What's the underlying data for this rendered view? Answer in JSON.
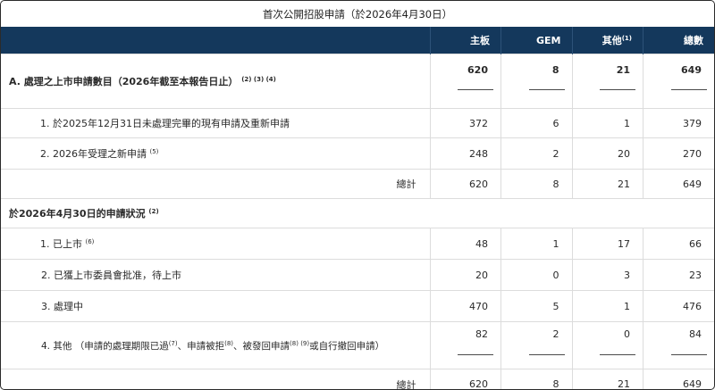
{
  "caption": "首次公開招股申請（於2026年4月30日）",
  "header": {
    "main_board": "主板",
    "gem": "GEM",
    "other": "其他",
    "other_note": "(1)",
    "total": "總數"
  },
  "section_a": {
    "label": "A. 處理之上市申請數目（2026年截至本報告日止）",
    "notes": "(2) (3) (4)",
    "values": [
      "620",
      "8",
      "21",
      "649"
    ],
    "rows": [
      {
        "label": "1. 於2025年12月31日未處理完畢的現有申請及重新申請",
        "note": "",
        "values": [
          "372",
          "6",
          "1",
          "379"
        ]
      },
      {
        "label": "2. 2026年受理之新申請",
        "note": "(5)",
        "values": [
          "248",
          "2",
          "20",
          "270"
        ]
      }
    ],
    "total": {
      "label": "總計",
      "values": [
        "620",
        "8",
        "21",
        "649"
      ]
    }
  },
  "section_b": {
    "label": "於2026年4月30日的申請狀況",
    "note": "(2)",
    "rows": [
      {
        "label": "1. 已上市",
        "note": "(6)",
        "values": [
          "48",
          "1",
          "17",
          "66"
        ]
      },
      {
        "label": "2. 已獲上市委員會批准，待上市",
        "note": "",
        "values": [
          "20",
          "0",
          "3",
          "23"
        ]
      },
      {
        "label": "3. 處理中",
        "note": "",
        "values": [
          "470",
          "5",
          "1",
          "476"
        ]
      }
    ],
    "other_row": {
      "prefix": "4. 其他 （申請的處理期限已過",
      "note7": "(7)",
      "part2": "、申請被拒",
      "note8": "(8)",
      "part3": "、被發回申請",
      "note89": "(8) (9)",
      "part4": "或自行撤回申請）",
      "values": [
        "82",
        "2",
        "0",
        "84"
      ]
    },
    "total": {
      "label": "總計",
      "values": [
        "620",
        "8",
        "21",
        "649"
      ]
    }
  }
}
